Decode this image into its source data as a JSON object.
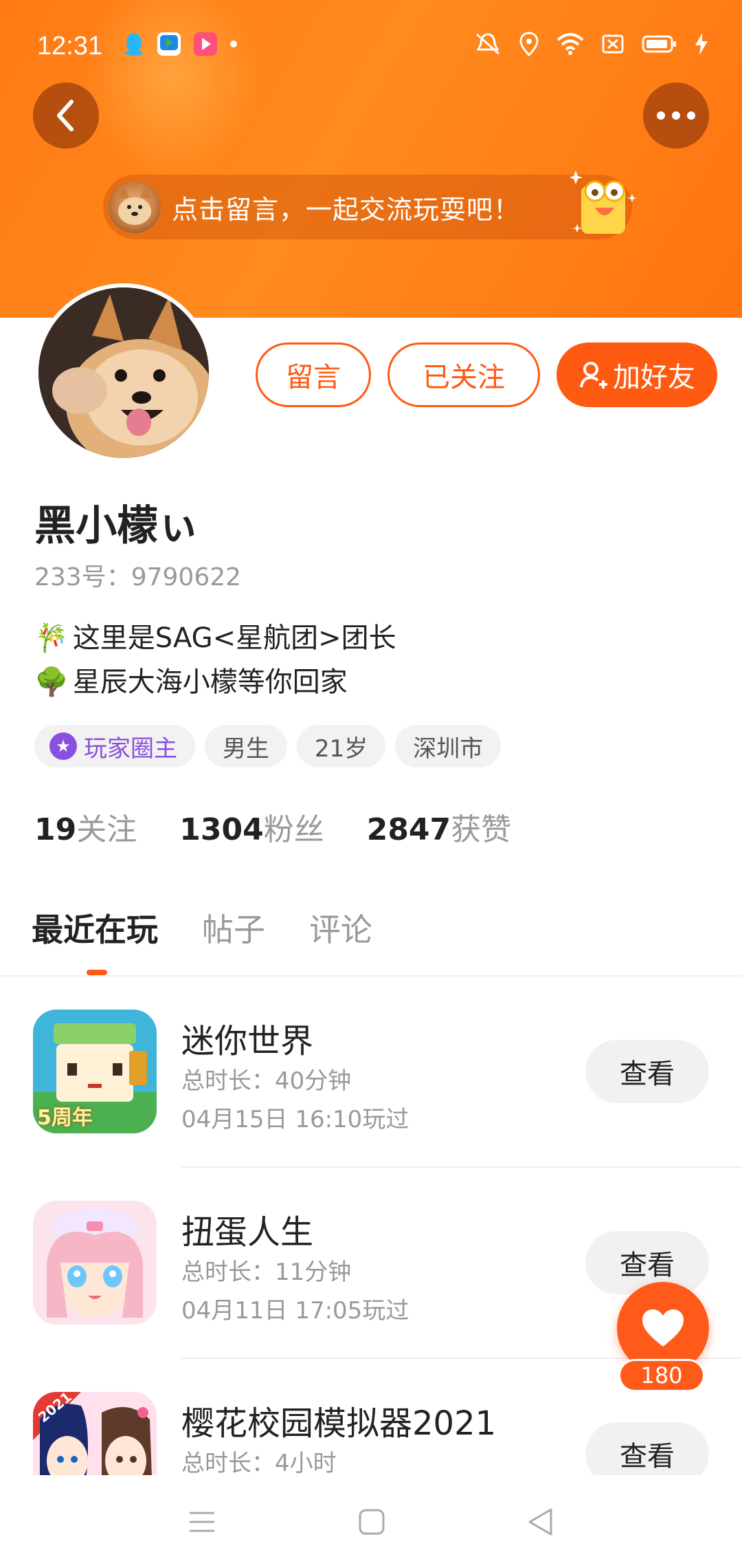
{
  "status_bar": {
    "time": "12:31",
    "left_icons": [
      "qq-icon",
      "video-app-icon",
      "media-app-icon",
      "dot-icon"
    ],
    "right_icons": [
      "mute-bell-icon",
      "location-icon",
      "wifi-icon",
      "sim-icon",
      "battery-icon",
      "charging-icon"
    ]
  },
  "header": {
    "banner_text": "点击留言，一起交流玩耍吧！"
  },
  "profile": {
    "nickname": "黑小檬ぃ",
    "uid": "233号：9790622",
    "bio_lines": [
      {
        "emoji": "🎋",
        "text": "这里是SAG<星航团>团长"
      },
      {
        "emoji": "🌳",
        "text": "星辰大海小檬等你回家"
      }
    ],
    "tags": [
      "玩家圈主",
      "男生",
      "21岁",
      "深圳市"
    ]
  },
  "actions": {
    "message": "留言",
    "followed": "已关注",
    "add_friend": "加好友"
  },
  "stats": [
    {
      "value": "19",
      "label": "关注"
    },
    {
      "value": "1304",
      "label": "粉丝"
    },
    {
      "value": "2847",
      "label": "获赞"
    }
  ],
  "tabs": [
    "最近在玩",
    "帖子",
    "评论"
  ],
  "games": [
    {
      "name": "迷你世界",
      "duration": "总时长：40分钟",
      "last_played": "04月15日 16:10玩过",
      "button": "查看"
    },
    {
      "name": "扭蛋人生",
      "duration": "总时长：11分钟",
      "last_played": "04月11日 17:05玩过",
      "button": "查看"
    },
    {
      "name": "樱花校园模拟器2021",
      "duration": "总时长：4小时",
      "last_played": "",
      "button": "查看"
    }
  ],
  "game_icon_texts": [
    "5周年",
    "2021"
  ],
  "like_count": "180",
  "colors": {
    "accent": "#ff5a12",
    "header": "#ff7a14",
    "host_purple": "#8a4fe0"
  }
}
